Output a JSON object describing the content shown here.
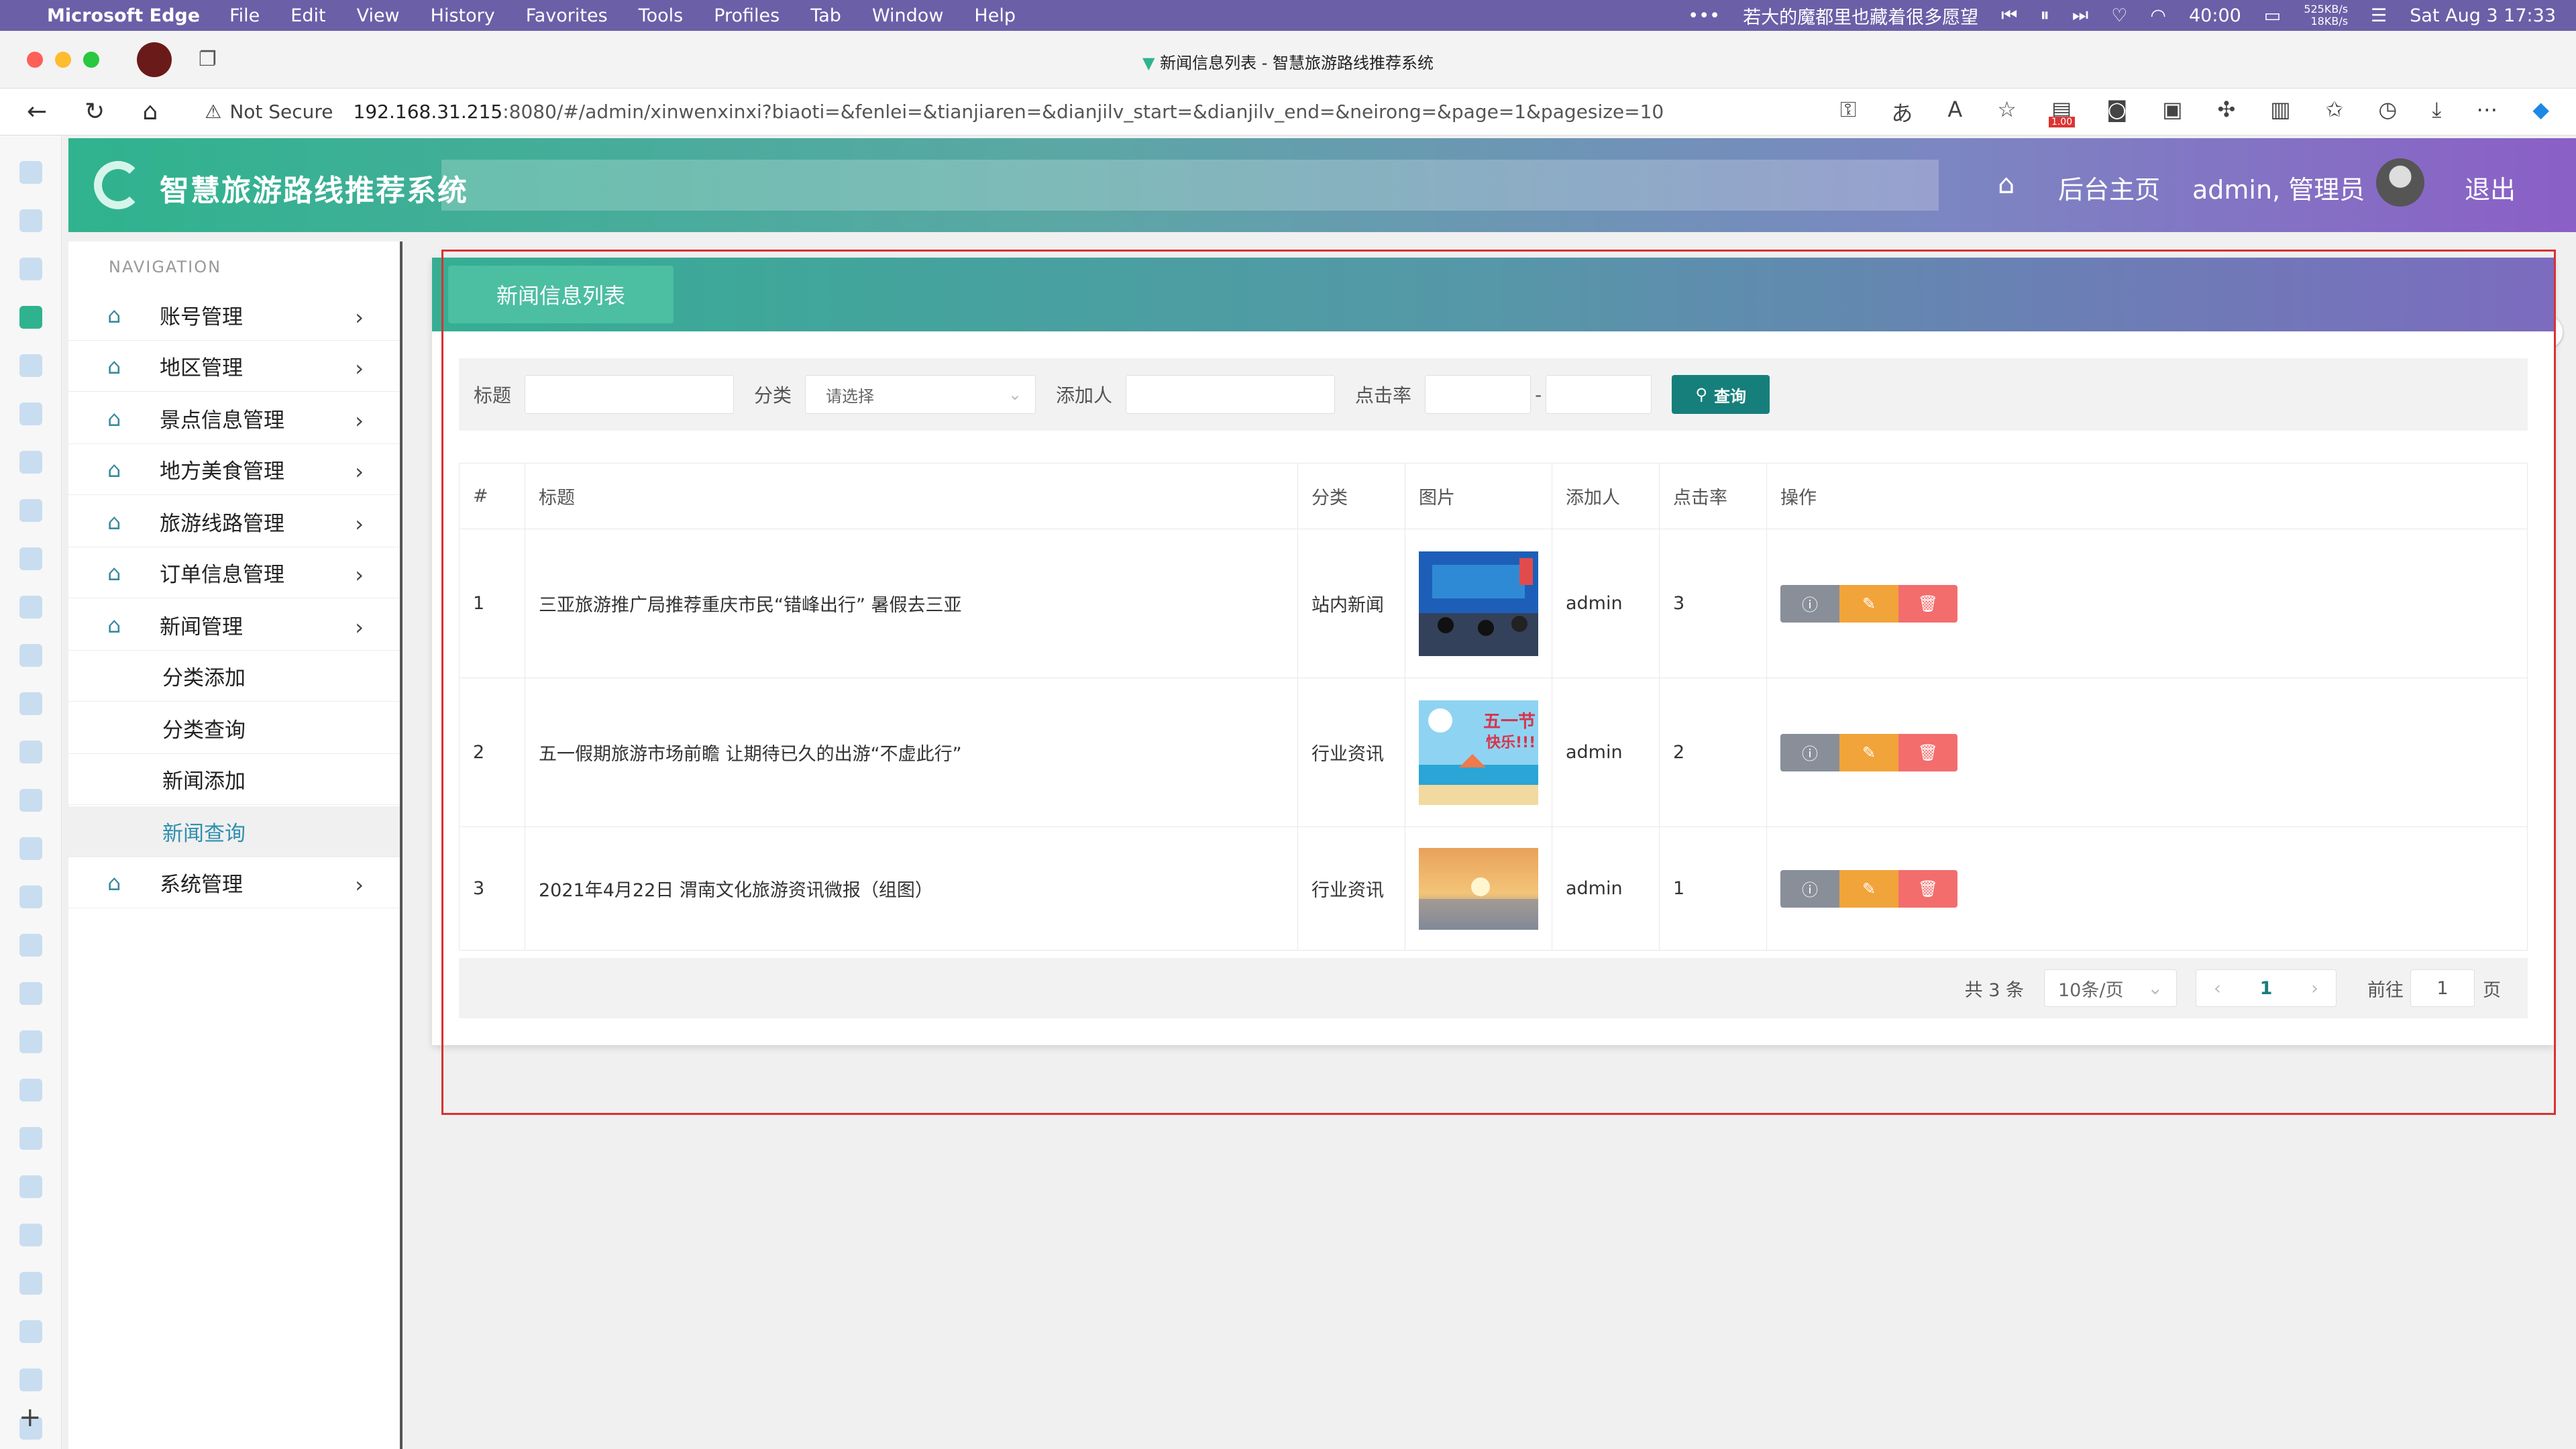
{
  "menubar": {
    "app": "Microsoft Edge",
    "items": [
      "File",
      "Edit",
      "View",
      "History",
      "Favorites",
      "Tools",
      "Profiles",
      "Tab",
      "Window",
      "Help"
    ],
    "song": "若大的魔都里也藏着很多愿望",
    "battery": "40:00",
    "net_up": "525KB/s",
    "net_down": "18KB/s",
    "datetime": "Sat Aug 3  17:33"
  },
  "browser": {
    "tab_title": "新闻信息列表 - 智慧旅游路线推荐系统",
    "security": "Not Secure",
    "url_host": "192.168.31.215",
    "url_rest": ":8080/#/admin/xinwenxinxi?biaoti=&fenlei=&tianjiaren=&dianjilv_start=&dianjilv_end=&neirong=&page=1&pagesize=10",
    "badge": "1.00"
  },
  "header": {
    "title": "智慧旅游路线推荐系统",
    "home_label": "后台主页",
    "user_label": "admin, 管理员",
    "logout_label": "退出"
  },
  "sidebar": {
    "nav_heading": "NAVIGATION",
    "items": [
      {
        "label": "账号管理"
      },
      {
        "label": "地区管理"
      },
      {
        "label": "景点信息管理"
      },
      {
        "label": "地方美食管理"
      },
      {
        "label": "旅游线路管理"
      },
      {
        "label": "订单信息管理"
      },
      {
        "label": "新闻管理"
      },
      {
        "label": "系统管理"
      }
    ],
    "sub_items": [
      {
        "label": "分类添加"
      },
      {
        "label": "分类查询"
      },
      {
        "label": "新闻添加"
      },
      {
        "label": "新闻查询"
      }
    ]
  },
  "panel": {
    "title": "新闻信息列表"
  },
  "search": {
    "title_label": "标题",
    "category_label": "分类",
    "category_placeholder": "请选择",
    "adder_label": "添加人",
    "clicks_label": "点击率",
    "range_sep": "-",
    "query_button": "查询"
  },
  "table": {
    "headers": [
      "#",
      "标题",
      "分类",
      "图片",
      "添加人",
      "点击率",
      "操作"
    ],
    "rows": [
      {
        "no": "1",
        "title": "三亚旅游推广局推荐重庆市民“错峰出行” 暑假去三亚",
        "category": "站内新闻",
        "adder": "admin",
        "clicks": "3"
      },
      {
        "no": "2",
        "title": "五一假期旅游市场前瞻 让期待已久的出游“不虚此行”",
        "category": "行业资讯",
        "adder": "admin",
        "clicks": "2"
      },
      {
        "no": "3",
        "title": "2021年4月22日 渭南文化旅游资讯微报（组图）",
        "category": "行业资讯",
        "adder": "admin",
        "clicks": "1"
      }
    ]
  },
  "pagination": {
    "total": "共 3 条",
    "page_size": "10条/页",
    "current_page": "1",
    "goto_label": "前往",
    "goto_value": "1",
    "page_suffix": "页"
  },
  "colors": {
    "accent": "#167f7b",
    "header_start": "#2fb38e",
    "header_end": "#8b5fc6",
    "detail_btn": "#888f99",
    "edit_btn": "#f1a43a",
    "delete_btn": "#f36d6d",
    "annotation": "#d63333"
  }
}
